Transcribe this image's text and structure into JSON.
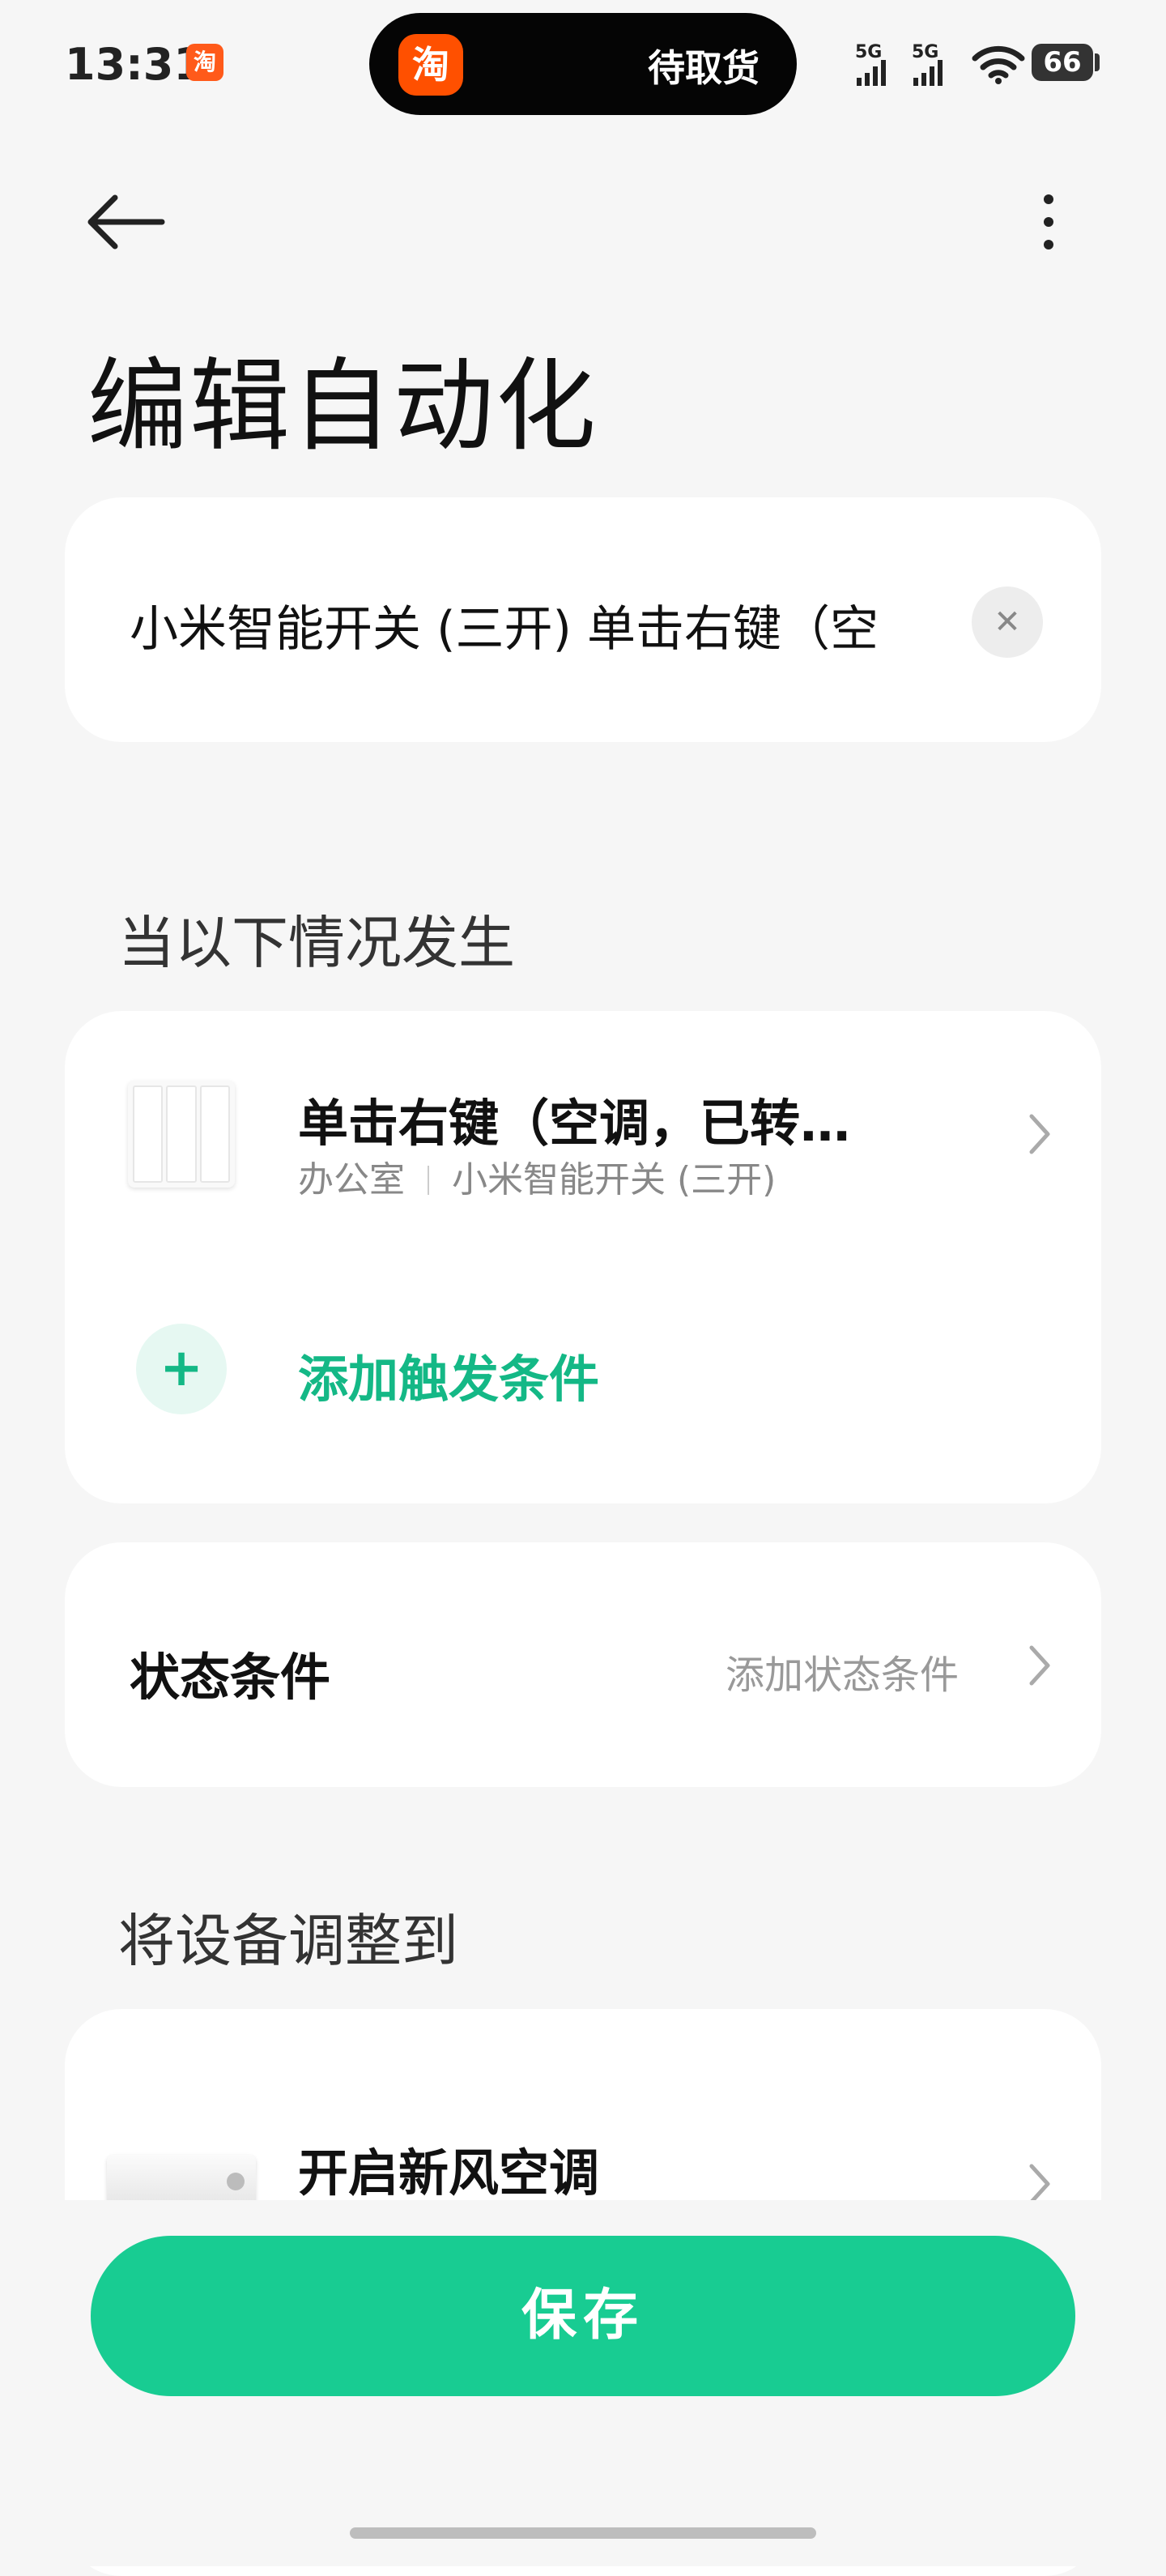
{
  "status_bar": {
    "time": "13:31",
    "taobao_badge": "淘",
    "island_app_icon": "淘",
    "island_text": "待取货",
    "network_1": "5G",
    "network_2": "5G",
    "battery": "66"
  },
  "header": {
    "back_icon": "arrow-left-icon",
    "more_icon": "more-vertical-icon",
    "title": "编辑自动化"
  },
  "automation_name": {
    "value": "小米智能开关 (三开) 单击右键（空",
    "clear_icon": "close-icon"
  },
  "trigger_section": {
    "label": "当以下情况发生",
    "items": [
      {
        "title": "单击右键（空调，已转…",
        "room": "办公室",
        "device": "小米智能开关 (三开)"
      }
    ],
    "add_label": "添加触发条件",
    "add_icon": "plus-icon"
  },
  "state_section": {
    "title": "状态条件",
    "action_text": "添加状态条件"
  },
  "action_section": {
    "label": "将设备调整到",
    "items": [
      {
        "title": "开启新风空调"
      }
    ]
  },
  "save_label": "保存",
  "colors": {
    "accent": "#18cc92",
    "accent_text": "#14b886",
    "background": "#f6f6f6"
  }
}
